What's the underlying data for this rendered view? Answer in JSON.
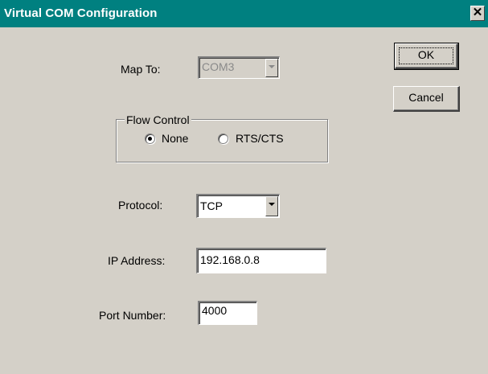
{
  "window": {
    "title": "Virtual COM Configuration",
    "close_glyph": "✕"
  },
  "map_to": {
    "label": "Map To:",
    "value": "COM3",
    "enabled": false
  },
  "flow_control": {
    "legend": "Flow Control",
    "options": [
      {
        "label": "None",
        "selected": true
      },
      {
        "label": "RTS/CTS",
        "selected": false
      }
    ]
  },
  "protocol": {
    "label": "Protocol:",
    "value": "TCP"
  },
  "ip_address": {
    "label": "IP Address:",
    "value": "192.168.0.8"
  },
  "port_number": {
    "label": "Port Number:",
    "value": "4000"
  },
  "buttons": {
    "ok": "OK",
    "cancel": "Cancel"
  },
  "colors": {
    "titlebar": "#008080",
    "face": "#d4d0c8"
  }
}
